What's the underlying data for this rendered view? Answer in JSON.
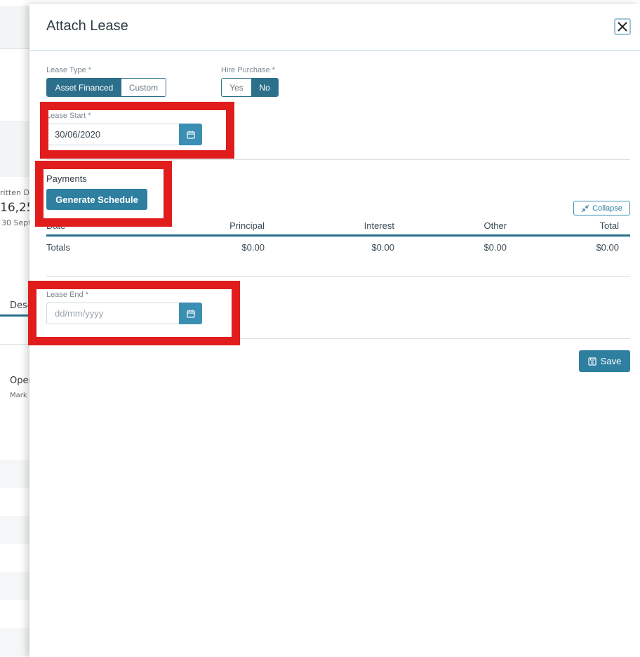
{
  "background": {
    "written_label": "ritten Da",
    "amount": "16,25",
    "date_label": "30 Sept",
    "desc_tab": "Desc",
    "open_label": "Oper",
    "mark_label": "Mark"
  },
  "modal": {
    "title": "Attach Lease",
    "close_icon": "close-icon"
  },
  "lease_type": {
    "label": "Lease Type *",
    "options": [
      "Asset Financed",
      "Custom"
    ],
    "selected": "Asset Financed"
  },
  "hire_purchase": {
    "label": "Hire Purchase *",
    "options": [
      "Yes",
      "No"
    ],
    "selected": "No"
  },
  "lease_start": {
    "label": "Lease Start *",
    "value": "30/06/2020",
    "icon": "calendar-icon"
  },
  "payments": {
    "title": "Payments",
    "generate_label": "Generate Schedule",
    "collapse_label": "Collapse",
    "table": {
      "columns": [
        "Date",
        "Principal",
        "Interest",
        "Other",
        "Total"
      ],
      "totals_row": [
        "Totals",
        "$0.00",
        "$0.00",
        "$0.00",
        "$0.00"
      ]
    }
  },
  "lease_end": {
    "label": "Lease End *",
    "placeholder": "dd/mm/yyyy",
    "icon": "calendar-icon"
  },
  "footer": {
    "save_label": "Save",
    "save_icon": "floppy-disk-icon"
  },
  "colors": {
    "primary": "#2b6f8a",
    "button": "#2e7fa0",
    "highlight": "#e11c1c"
  }
}
